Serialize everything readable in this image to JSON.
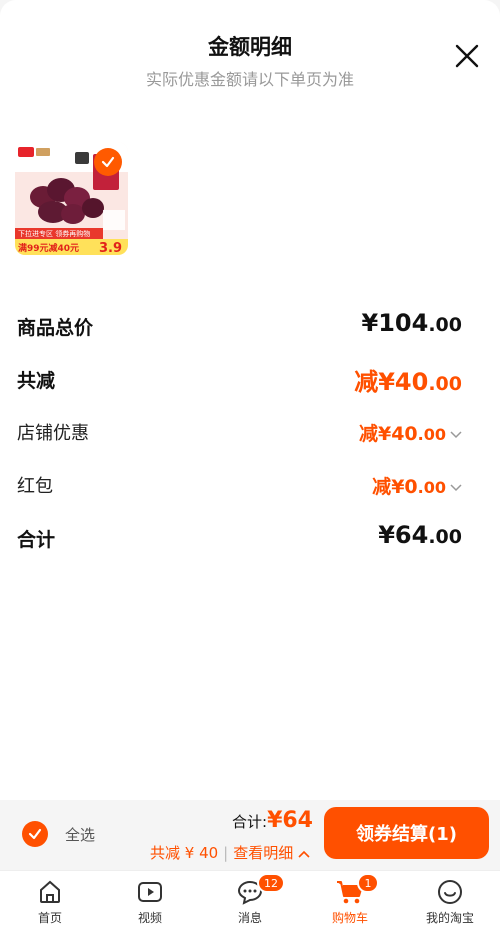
{
  "header": {
    "title": "金额明细",
    "subtitle": "实际优惠金额请以下单页为准"
  },
  "product": {
    "image": "product-thumbnail",
    "selected": true,
    "promo_line1": "下拉进专区 领券再购物",
    "promo_line2": "满99元减40元",
    "price_tag": "3.9"
  },
  "summary": {
    "rows": [
      {
        "label": "商品总价",
        "prefix": "",
        "yen": "¥",
        "integer": "104",
        "decimal": ".00"
      },
      {
        "label": "共减",
        "prefix": "减",
        "yen": "¥",
        "integer": "40",
        "decimal": ".00"
      },
      {
        "label": "店铺优惠",
        "prefix": "减",
        "yen": "¥",
        "integer": "40",
        "decimal": ".00"
      },
      {
        "label": "红包",
        "prefix": "减",
        "yen": "¥",
        "integer": "0",
        "decimal": ".00"
      },
      {
        "label": "合计",
        "prefix": "",
        "yen": "¥",
        "integer": "64",
        "decimal": ".00"
      }
    ]
  },
  "bottom": {
    "select_all": "全选",
    "total_label": "合计:",
    "total_value": "¥64",
    "reduce_text": "共减 ¥ 40",
    "detail_link": "查看明细",
    "checkout": "领券结算(1)"
  },
  "tabbar": {
    "items": [
      {
        "label": "首页",
        "icon": "home-icon"
      },
      {
        "label": "视频",
        "icon": "video-icon"
      },
      {
        "label": "消息",
        "icon": "message-icon",
        "badge": "12"
      },
      {
        "label": "购物车",
        "icon": "cart-icon",
        "badge": "1"
      },
      {
        "label": "我的淘宝",
        "icon": "profile-icon"
      }
    ]
  },
  "colors": {
    "accent": "#ff5000",
    "text": "#111111",
    "muted": "#999999"
  }
}
